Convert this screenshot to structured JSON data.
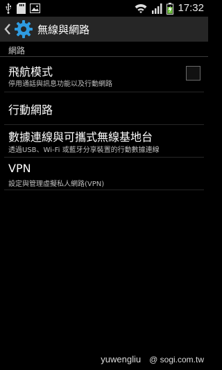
{
  "status_bar": {
    "time": "17:32",
    "icons": [
      "usb-icon",
      "sd-card-icon",
      "image-notification-icon",
      "wifi-icon",
      "signal-icon",
      "battery-charging-icon"
    ]
  },
  "action_bar": {
    "title": "無線與網路",
    "icons": [
      "back-chevron-icon",
      "settings-gear-icon"
    ],
    "accent": "#2f9be0"
  },
  "section": {
    "header": "網路"
  },
  "items": [
    {
      "title": "飛航模式",
      "summary": "停用通話與訊息功能以及行動網路",
      "checked": false
    },
    {
      "title": "行動網路",
      "summary": ""
    },
    {
      "title": "數據連線與可攜式無線基地台",
      "summary": "透過USB、Wi-Fi 或藍牙分享裝置的行動數據連線"
    },
    {
      "title": "VPN",
      "summary": "設定與管理虛擬私人網路(VPN)"
    }
  ],
  "watermark": {
    "user": "yuwengliu",
    "site": "@ sogi.com.tw"
  }
}
